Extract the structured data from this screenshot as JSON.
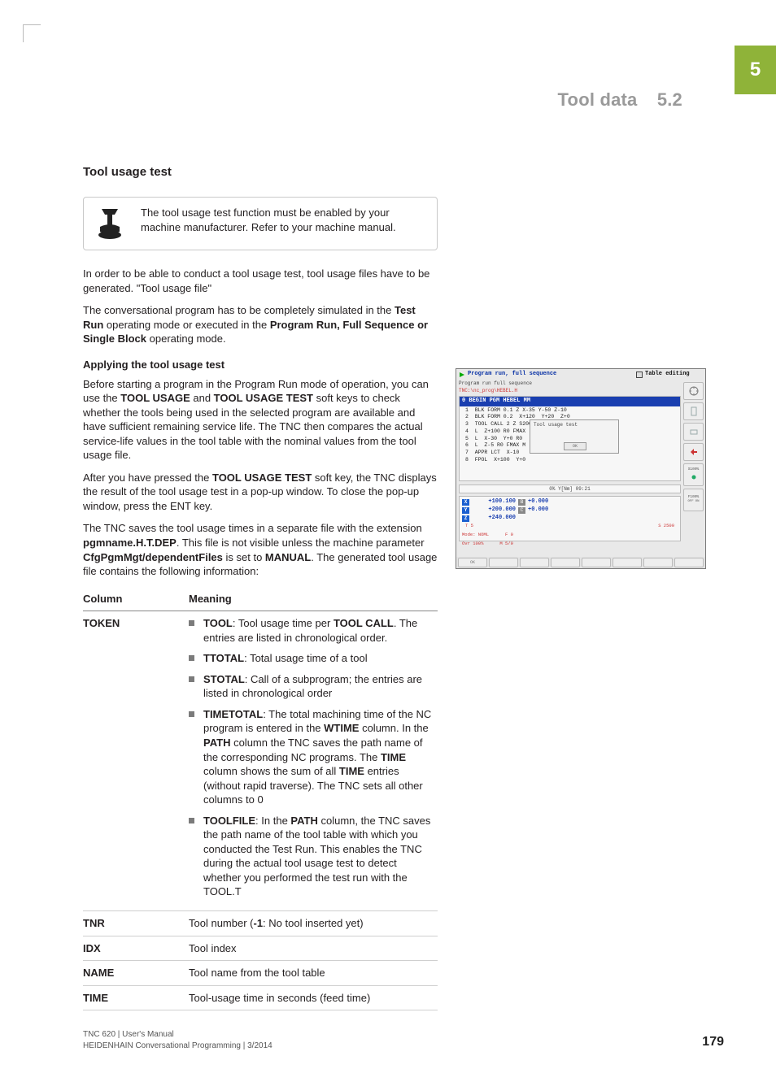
{
  "chapter_tab": "5",
  "running_head": {
    "title": "Tool data",
    "section": "5.2"
  },
  "section_title": "Tool usage test",
  "note": "The tool usage test function must be enabled by your machine manufacturer. Refer to your machine manual.",
  "para1": "In order to be able to conduct a tool usage test, tool usage files have to be generated. \"Tool usage file\"",
  "para2_pre": "The conversational program has to be completely simulated in the ",
  "para2_b1": "Test Run",
  "para2_mid": " operating mode or executed in the ",
  "para2_b2": "Program Run, Full Sequence or Single Block",
  "para2_post": " operating mode.",
  "subhead": "Applying the tool usage test",
  "para3_a": "Before starting a program in the Program Run mode of operation, you can use the ",
  "para3_b1": "TOOL USAGE",
  "para3_b": " and ",
  "para3_b2": "TOOL USAGE TEST",
  "para3_c": " soft keys to check whether the tools being used in the selected program are available and have sufficient remaining service life. The TNC then compares the actual service-life values in the tool table with the nominal values from the tool usage file.",
  "para4_a": "After you have pressed the ",
  "para4_b1": "TOOL USAGE TEST",
  "para4_b": " soft key, the TNC displays the result of the tool usage test in a pop-up window. To close the pop-up window, press the ENT key.",
  "para5_a": "The TNC saves the tool usage times in a separate file with the extension ",
  "para5_b1": "pgmname.H.T.DEP",
  "para5_b": ". This file is not visible unless the machine parameter ",
  "para5_b2": "CfgPgmMgt/dependentFiles",
  "para5_c": " is set to ",
  "para5_b3": "MANUAL",
  "para5_d": ". The generated tool usage file contains the following information:",
  "table": {
    "head": {
      "c1": "Column",
      "c2": "Meaning"
    },
    "rows": [
      {
        "c1": "TOKEN",
        "items": [
          {
            "b": "TOOL",
            "t": ": Tool usage time per ",
            "b2": "TOOL CALL",
            "t2": ". The entries are listed in chronological order."
          },
          {
            "b": "TTOTAL",
            "t": ": Total usage time of a tool"
          },
          {
            "b": "STOTAL",
            "t": ": Call of a subprogram; the entries are listed in chronological order"
          },
          {
            "b": "TIMETOTAL",
            "t": ": The total machining time of the NC program is entered in the ",
            "b2": "WTIME",
            "t2": " column. In the ",
            "b3": "PATH",
            "t3": " column the TNC saves the path name of the corresponding NC programs. The ",
            "b4": "TIME",
            "t4": " column shows the sum of all ",
            "b5": "TIME",
            "t5": " entries (without rapid traverse). The TNC sets all other columns to 0"
          },
          {
            "b": "TOOLFILE",
            "t": ": In the ",
            "b2": "PATH",
            "t2": " column, the TNC saves the path name of the tool table with which you conducted the Test Run. This enables the TNC during the actual tool usage test to detect whether you performed the test run with the TOOL.T"
          }
        ]
      },
      {
        "c1": "TNR",
        "plain_a": "Tool number (",
        "plain_b": "-1",
        "plain_c": ": No tool inserted yet)"
      },
      {
        "c1": "IDX",
        "plain": "Tool index"
      },
      {
        "c1": "NAME",
        "plain": "Tool name from the tool table"
      },
      {
        "c1": "TIME",
        "plain": "Tool-usage time in seconds (feed time)"
      }
    ]
  },
  "shot": {
    "mode": "Program run, full sequence",
    "mode2": "Table editing",
    "subtitle": "Program run full sequence",
    "path": "TNC:\\nc_prog\\HEBEL.H",
    "line0": "0  BEGIN PGM HEBEL MM",
    "code": "1  BLK FORM 0.1 Z X-35 Y-50 Z-10\n2  BLK FORM 0.2  X+120  Y+20  Z+0\n3  TOOL CALL 2 Z S2000 F500\n4  L  Z+100 R0 FMAX\n5  L  X-30  Y+0 R0\n6  L  Z-5 R0 FMAX M\n7  APPR LCT  X-10\n8  FPOL  X+100  Y+0",
    "popup_title": "Tool usage test",
    "popup_ok": "OK",
    "progress": "0% Y[Nm] 09:21",
    "dro": {
      "X": "+100.100",
      "B": "+0.000",
      "Y": "+200.000",
      "C": "+0.000",
      "Z": "+240.000",
      "t": "T 5",
      "s": "S 2500",
      "mode_lbl": "Mode: NOML",
      "f": "F 0",
      "ovr": "Ovr 100%",
      "m": "M 5/9"
    },
    "sk_ok": "OK",
    "side": {
      "s100": "S100%",
      "f100": "F100%",
      "off": "OFF",
      "on": "ON"
    }
  },
  "footer": {
    "l1": "TNC 620 | User's Manual",
    "l2": "HEIDENHAIN Conversational Programming | 3/2014",
    "page": "179"
  }
}
